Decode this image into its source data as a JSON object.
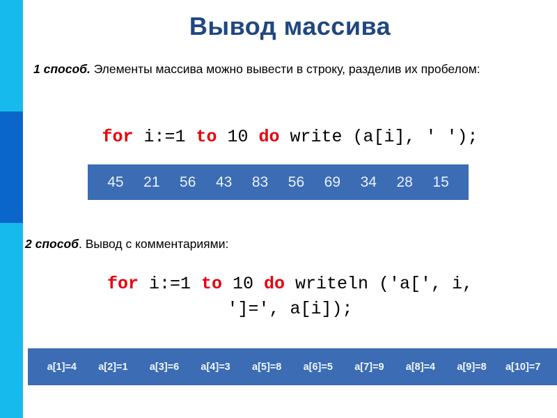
{
  "slide": {
    "title": "Вывод массива",
    "background_color": "#FFFFFF"
  },
  "sidebar": {
    "segments": [
      {
        "name": "top",
        "color": "#17BAEC"
      },
      {
        "name": "middle",
        "color": "#0B66CC"
      },
      {
        "name": "bottom",
        "color": "#17BAEC"
      }
    ]
  },
  "method_1": {
    "lead": "1 способ.",
    "text": " Элементы массива можно вывести в строку, разделив их пробелом:",
    "code": {
      "kw_for": "for",
      "mid_1": " i:=1 ",
      "kw_to": "to",
      "mid_2": " 10 ",
      "kw_do": "do",
      "tail": " write (a[i], ' ');"
    },
    "output_values": [
      "45",
      "21",
      "56",
      "43",
      "83",
      "56",
      "69",
      "34",
      "28",
      "15"
    ],
    "output_box_color": "#3B6CB4"
  },
  "method_2": {
    "lead": "2 способ",
    "text": ". Вывод с комментариями:",
    "code": {
      "kw_for": "for",
      "mid_1": " i:=1 ",
      "kw_to": "to",
      "mid_2": " 10 ",
      "kw_do": "do",
      "tail": " writeln ('a[', i,",
      "line_2": "']=', a[i]);"
    },
    "output_pairs": [
      "a[1]=4",
      "a[2]=1",
      "a[3]=6",
      "a[4]=3",
      "a[5]=8",
      "a[6]=5",
      "a[7]=9",
      "a[8]=4",
      "a[9]=8",
      "a[10]=7"
    ],
    "output_box_color": "#3B6CB4"
  },
  "colors": {
    "title": "#21477E",
    "keyword_red": "#E8000C",
    "cyan": "#17BAEC",
    "blue": "#0B66CC",
    "box_blue": "#3B6CB4"
  }
}
